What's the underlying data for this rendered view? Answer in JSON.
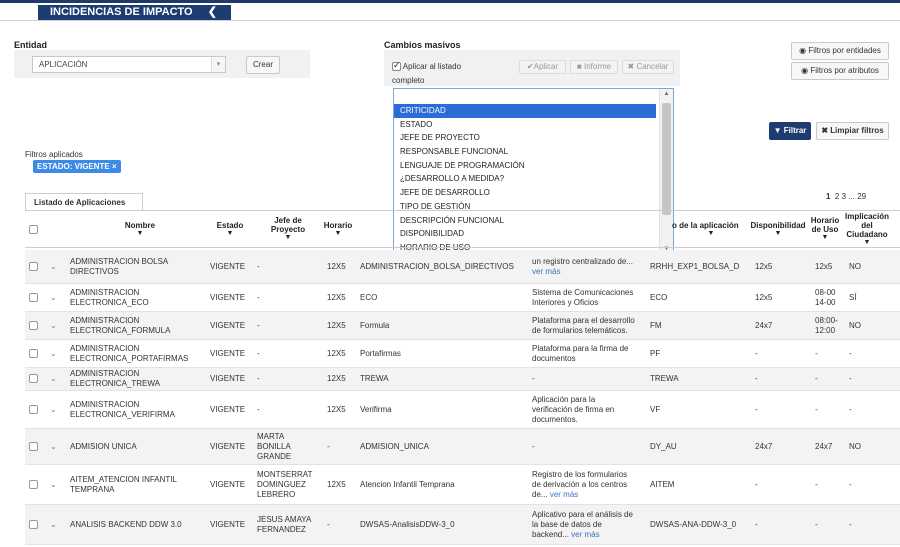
{
  "header": {
    "title": "INCIDENCIAS DE IMPACTO",
    "collapse_icon": "chevron-left-icon"
  },
  "entidad": {
    "label": "Entidad",
    "selected": "APLICACIÓN",
    "create_label": "Crear"
  },
  "masivos": {
    "label": "Cambios masivos",
    "apply_all_line1": "Aplicar al listado",
    "apply_all_line2": "completo",
    "apply_all_checked": true,
    "aplicar_label": "Aplicar",
    "informe_label": "Informe",
    "cancelar_label": "Cancelar",
    "options": [
      "CRITICIDAD",
      "ESTADO",
      "JEFE DE PROYECTO",
      "RESPONSABLE FUNCIONAL",
      "LENGUAJE DE PROGRAMACIÓN",
      "¿DESARROLLO A MEDIDA?",
      "JEFE DE DESARROLLO",
      "TIPO DE GESTIÓN",
      "DESCRIPCIÓN FUNCIONAL",
      "DISPONIBILIDAD",
      "HORARIO DE USO"
    ],
    "selected_option": "CRITICIDAD"
  },
  "filters": {
    "by_entity_label": "Filtros por entidades",
    "by_attr_label": "Filtros por atributos",
    "filter_label": "Filtrar",
    "clear_label": "Limpiar filtros",
    "applied_label": "Filtros aplicados",
    "applied_badge": "ESTADO: VIGENTE ×"
  },
  "list": {
    "tab_label": "Listado de Aplicaciones",
    "pager": {
      "current": "1",
      "p2": "2",
      "p3": "3",
      "ellipsis": "...",
      "last": "29"
    },
    "columns": {
      "nombre": "Nombre",
      "estado": "Estado",
      "jefe_1": "Jefe de",
      "jefe_2": "Proyecto",
      "horario": "Horario",
      "codigo_aplicacion": "o de la aplicación",
      "disponibilidad": "Disponibilidad",
      "horario_uso_1": "Horario",
      "horario_uso_2": "de Uso",
      "implicacion_1": "Implicación",
      "implicacion_2": "del",
      "implicacion_3": "Ciudadano"
    },
    "ver_mas": "ver más",
    "rows": [
      {
        "n1": "ADMINISTRACION BOLSA",
        "n2": "DIRECTIVOS",
        "estado": "VIGENTE",
        "jefe": [
          "-"
        ],
        "horario": "12X5",
        "codigo": "ADMINISTRACION_BOLSA_DIRECTIVOS",
        "desc": [
          "un registro centralizado de..."
        ],
        "more": true,
        "app": "RRHH_EXP1_BOLSA_D",
        "disp": "12x5",
        "uso": [
          "12x5"
        ],
        "impl": "NO"
      },
      {
        "n1": "ADMINISTRACION",
        "n2": "ELECTRONICA_ECO",
        "estado": "VIGENTE",
        "jefe": [
          "-"
        ],
        "horario": "12X5",
        "codigo": "ECO",
        "desc": [
          "Sistema de Comunicaciones",
          "Interiores y Oficios"
        ],
        "more": false,
        "app": "ECO",
        "disp": "12x5",
        "uso": [
          "08-00",
          "14-00"
        ],
        "impl": "SÍ"
      },
      {
        "n1": "ADMINISTRACION",
        "n2": "ELECTRONICA_FORMULA",
        "estado": "VIGENTE",
        "jefe": [
          "-"
        ],
        "horario": "12X5",
        "codigo": "Formula",
        "desc": [
          "Plataforma para el desarrollo",
          "de formularios telemáticos."
        ],
        "more": false,
        "app": "FM",
        "disp": "24x7",
        "uso": [
          "08:00-",
          "12:00"
        ],
        "impl": "NO"
      },
      {
        "n1": "ADMINISTRACION",
        "n2": "ELECTRONICA_PORTAFIRMAS",
        "estado": "VIGENTE",
        "jefe": [
          "-"
        ],
        "horario": "12X5",
        "codigo": "Portafirmas",
        "desc": [
          "Plataforma para la firma de",
          "documentos"
        ],
        "more": false,
        "app": "PF",
        "disp": "-",
        "uso": [
          "-"
        ],
        "impl": "-"
      },
      {
        "n1": "ADMINISTRACION",
        "n2": "ELECTRONICA_TREWA",
        "estado": "VIGENTE",
        "jefe": [
          "-"
        ],
        "horario": "12X5",
        "codigo": "TREWA",
        "desc": [
          "-"
        ],
        "more": false,
        "app": "TREWA",
        "disp": "-",
        "uso": [
          "-"
        ],
        "impl": "-"
      },
      {
        "n1": "ADMINISTRACION",
        "n2": "ELECTRONICA_VERIFIRMA",
        "estado": "VIGENTE",
        "jefe": [
          "-"
        ],
        "horario": "12X5",
        "codigo": "Verifirma",
        "desc": [
          "Aplicación para la",
          "verificación de firma en",
          "documentos."
        ],
        "more": false,
        "app": "VF",
        "disp": "-",
        "uso": [
          "-"
        ],
        "impl": "-"
      },
      {
        "n1": "ADMISION UNICA",
        "n2": "",
        "estado": "VIGENTE",
        "jefe": [
          "MARTA",
          "BONILLA",
          "GRANDE"
        ],
        "horario": "-",
        "codigo": "ADMISION_UNICA",
        "desc": [
          "-"
        ],
        "more": false,
        "app": "DY_AU",
        "disp": "24x7",
        "uso": [
          "24x7"
        ],
        "impl": "NO"
      },
      {
        "n1": "AITEM_ATENCION INFANTIL",
        "n2": "TEMPRANA",
        "estado": "VIGENTE",
        "jefe": [
          "MONTSERRAT",
          "DOMINGUEZ",
          "LEBRERO"
        ],
        "horario": "12X5",
        "codigo": "Atencion Infantil Temprana",
        "desc": [
          "Registro de los formularios",
          "de derivación a los centros",
          "de..."
        ],
        "more": true,
        "app": "AITEM",
        "disp": "-",
        "uso": [
          "-"
        ],
        "impl": "-"
      },
      {
        "n1": "ANALISIS BACKEND DDW 3.0",
        "n2": "",
        "estado": "VIGENTE",
        "jefe": [
          "JESUS AMAYA",
          "FERNANDEZ"
        ],
        "horario": "-",
        "codigo": "DWSAS-AnalisisDDW-3_0",
        "desc": [
          "Aplicativo para el análisis de",
          "la base de datos de",
          "backend..."
        ],
        "more": true,
        "app": "DWSAS-ANA-DDW-3_0",
        "disp": "-",
        "uso": [
          "-"
        ],
        "impl": "-"
      }
    ]
  }
}
